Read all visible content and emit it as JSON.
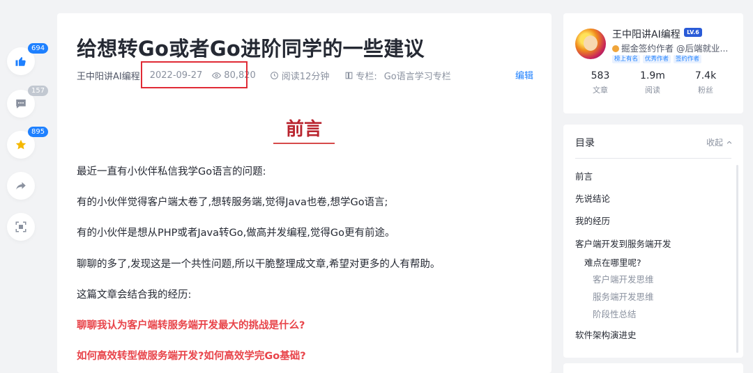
{
  "article": {
    "title": "给想转Go或者Go进阶同学的一些建议",
    "author": "王中阳讲AI编程",
    "date": "2022-09-27",
    "views": "80,820",
    "read_time": "阅读12分钟",
    "column_label": "专栏:",
    "column_name": "Go语言学习专栏",
    "edit_label": "编辑",
    "heading": "前言",
    "paragraphs": [
      "最近一直有小伙伴私信我学Go语言的问题:",
      "有的小伙伴觉得客户端太卷了,想转服务端,觉得Java也卷,想学Go语言;",
      "有的小伙伴是想从PHP或者Java转Go,做高并发编程,觉得Go更有前途。",
      "聊聊的多了,发现这是一个共性问题,所以干脆整理成文章,希望对更多的人有帮助。",
      "这篇文章会结合我的经历:"
    ],
    "red_paragraphs": [
      "聊聊我认为客户端转服务端开发最大的挑战是什么?",
      "如何高效转型做服务端开发?如何高效学完Go基础?"
    ]
  },
  "actions": {
    "like_count": "694",
    "comment_count": "157",
    "collect_count": "895"
  },
  "author_card": {
    "name": "王中阳讲AI编程",
    "level": "LV.6",
    "desc": "掘金签约作者 @后端就业...",
    "tags": [
      "榜上有名",
      "优秀作者",
      "签约作者"
    ],
    "stats": [
      {
        "num": "583",
        "label": "文章"
      },
      {
        "num": "1.9m",
        "label": "阅读"
      },
      {
        "num": "7.4k",
        "label": "粉丝"
      }
    ]
  },
  "toc": {
    "title": "目录",
    "collapse_label": "收起",
    "items": [
      {
        "label": "前言",
        "level": 1
      },
      {
        "label": "先说结论",
        "level": 1
      },
      {
        "label": "我的经历",
        "level": 1
      },
      {
        "label": "客户端开发到服务端开发",
        "level": 1
      },
      {
        "label": "难点在哪里呢?",
        "level": 2
      },
      {
        "label": "客户端开发思维",
        "level": 3
      },
      {
        "label": "服务端开发思维",
        "level": 3
      },
      {
        "label": "阶段性总结",
        "level": 3
      },
      {
        "label": "软件架构演进史",
        "level": 1
      }
    ]
  },
  "colors": {
    "accent": "#1e80ff",
    "highlight_box": "#e02a35",
    "heading": "#b9252f",
    "red_text": "#e8444a"
  }
}
